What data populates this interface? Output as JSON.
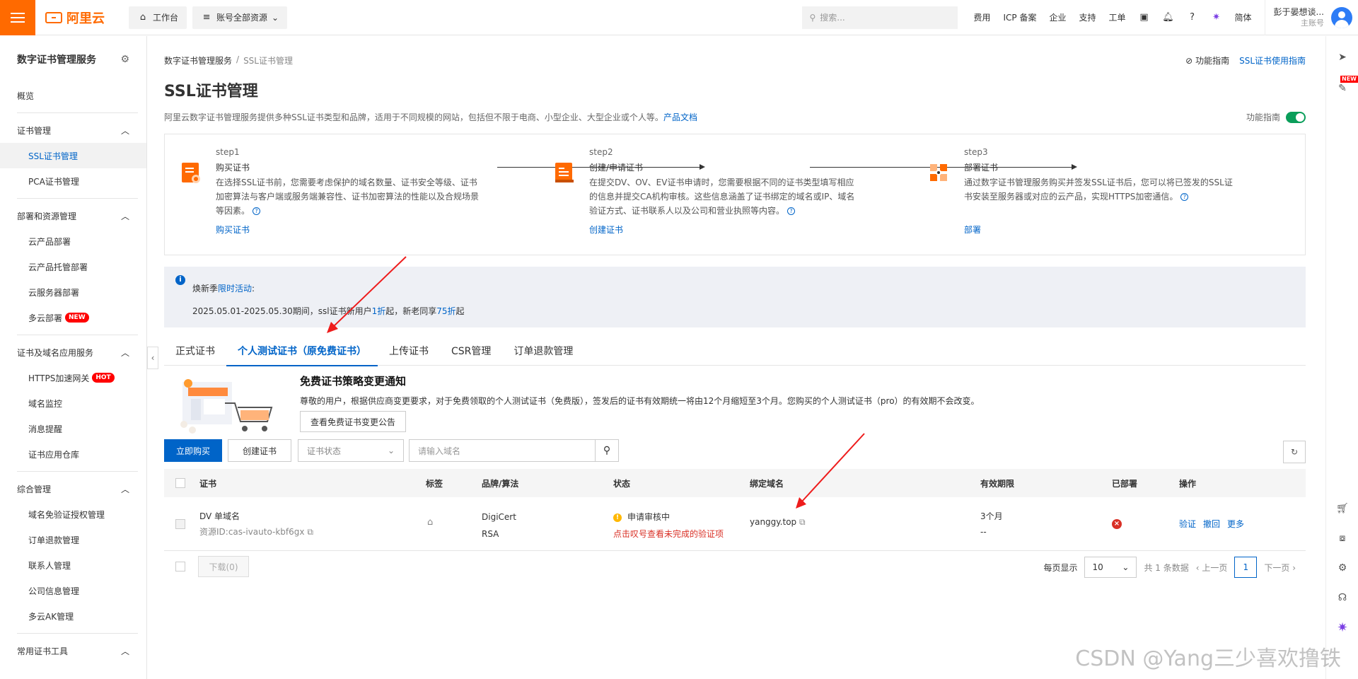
{
  "topbar": {
    "brand": "阿里云",
    "workbench": "工作台",
    "resources": "账号全部资源",
    "search_placeholder": "搜索...",
    "links": [
      "费用",
      "ICP 备案",
      "企业",
      "支持",
      "工单"
    ],
    "lang": "简体",
    "user_name": "彭于晏想谈...",
    "user_role": "主账号"
  },
  "sidebar": {
    "title": "数字证书管理服务",
    "overview": "概览",
    "groups": [
      {
        "label": "证书管理",
        "items": [
          "SSL证书管理",
          "PCA证书管理"
        ]
      },
      {
        "label": "部署和资源管理",
        "items": [
          "云产品部署",
          "云产品托管部署",
          "云服务器部署",
          "多云部署"
        ]
      },
      {
        "label": "证书及域名应用服务",
        "items": [
          "HTTPS加速网关",
          "域名监控",
          "消息提醒",
          "证书应用仓库"
        ]
      },
      {
        "label": "综合管理",
        "items": [
          "域名免验证授权管理",
          "订单退款管理",
          "联系人管理",
          "公司信息管理",
          "多云AK管理"
        ]
      },
      {
        "label": "常用证书工具",
        "items": []
      }
    ],
    "badge_new": "NEW",
    "badge_hot": "HOT"
  },
  "header": {
    "breadcrumb": [
      "数字证书管理服务",
      "SSL证书管理"
    ],
    "guide_func": "功能指南",
    "guide_ssl": "SSL证书使用指南",
    "title": "SSL证书管理",
    "desc": "阿里云数字证书管理服务提供多种SSL证书类型和品牌，适用于不同规模的网站，包括但不限于电商、小型企业、大型企业或个人等。",
    "desc_link": "产品文档",
    "toggle_label": "功能指南"
  },
  "steps": [
    {
      "label": "step1",
      "name": "购买证书",
      "text": "在选择SSL证书前，您需要考虑保护的域名数量、证书安全等级、证书加密算法与客户端或服务端兼容性、证书加密算法的性能以及合规场景等因素。",
      "link": "购买证书"
    },
    {
      "label": "step2",
      "name": "创建/申请证书",
      "text": "在提交DV、OV、EV证书申请时，您需要根据不同的证书类型填写相应的信息并提交CA机构审核。这些信息涵盖了证书绑定的域名或IP、域名验证方式、证书联系人以及公司和营业执照等内容。",
      "link": "创建证书"
    },
    {
      "label": "step3",
      "name": "部署证书",
      "text": "通过数字证书管理服务购买并签发SSL证书后，您可以将已签发的SSL证书安装至服务器或对应的云产品，实现HTTPS加密通信。",
      "link": "部署"
    }
  ],
  "promo": {
    "title": "焕新季",
    "title_link": "限时活动",
    "title_suffix": ":",
    "line2_a": "2025.05.01-2025.05.30期间，ssl证书新用户",
    "line2_b": "1折",
    "line2_c": "起，新老同享",
    "line2_d": "75折",
    "line2_e": "起"
  },
  "tabs": [
    "正式证书",
    "个人测试证书（原免费证书）",
    "上传证书",
    "CSR管理",
    "订单退款管理"
  ],
  "notice": {
    "title": "免费证书策略变更通知",
    "text": "尊敬的用户，根据供应商变更要求，对于免费领取的个人测试证书（免费版），签发后的证书有效期统一将由12个月缩短至3个月。您购买的个人测试证书（pro）的有效期不会改变。",
    "button": "查看免费证书变更公告"
  },
  "toolbar": {
    "buy": "立即购买",
    "create": "创建证书",
    "status_placeholder": "证书状态",
    "search_placeholder": "请输入域名"
  },
  "table": {
    "headers": [
      "证书",
      "标签",
      "品牌/算法",
      "状态",
      "绑定域名",
      "有效期限",
      "已部署",
      "操作"
    ],
    "rows": [
      {
        "cert_name": "DV 单域名",
        "resource_id": "资源ID:cas-ivauto-kbf6gx",
        "brand": "DigiCert",
        "algo": "RSA",
        "status": "申请审核中",
        "status_hint": "点击叹号查看未完成的验证项",
        "domain": "yanggy.top",
        "validity": "3个月",
        "validity_sub": "--",
        "actions": [
          "验证",
          "撤回",
          "更多"
        ]
      }
    ]
  },
  "pager": {
    "download": "下载(0)",
    "per_page_label": "每页显示",
    "per_page": "10",
    "total": "共 1 条数据",
    "prev": "上一页",
    "page": "1",
    "next": "下一页"
  },
  "watermark": "CSDN @Yang三少喜欢撸铁",
  "colors": {
    "brand": "#ff6a00",
    "primary": "#0064c8",
    "error": "#d93026",
    "toggle": "#0a9e5a"
  }
}
